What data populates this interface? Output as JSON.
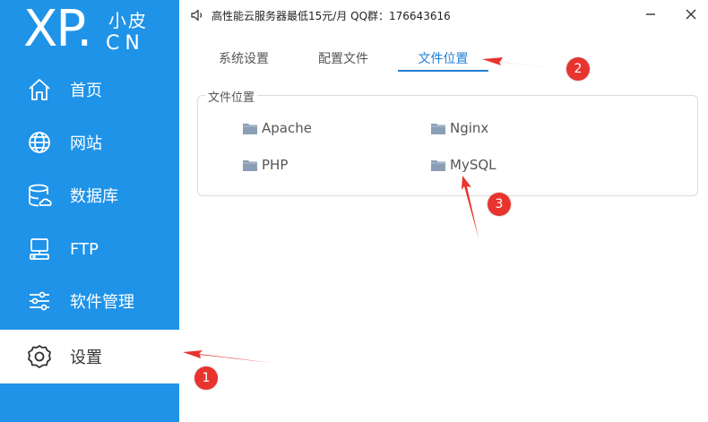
{
  "logo": {
    "main": "XP.",
    "cn": "小皮",
    "en": "CN"
  },
  "sidebar": {
    "items": [
      {
        "label": "首页",
        "icon": "home-icon"
      },
      {
        "label": "网站",
        "icon": "globe-icon"
      },
      {
        "label": "数据库",
        "icon": "database-icon"
      },
      {
        "label": "FTP",
        "icon": "server-icon"
      },
      {
        "label": "软件管理",
        "icon": "sliders-icon"
      },
      {
        "label": "设置",
        "icon": "gear-icon",
        "active": true
      }
    ]
  },
  "topbar": {
    "notice": "高性能云服务器最低15元/月   QQ群：176643616",
    "speaker_icon": "speaker-icon"
  },
  "tabs": [
    {
      "label": "系统设置"
    },
    {
      "label": "配置文件"
    },
    {
      "label": "文件位置",
      "active": true
    }
  ],
  "file_location": {
    "title": "文件位置",
    "folders": [
      "Apache",
      "Nginx",
      "PHP",
      "MySQL"
    ]
  },
  "annotations": [
    "1",
    "2",
    "3"
  ],
  "colors": {
    "sidebar": "#1f93e8",
    "accent": "#1f7fd6",
    "annotation": "#e8342e",
    "folder": "#8a9fb5"
  }
}
